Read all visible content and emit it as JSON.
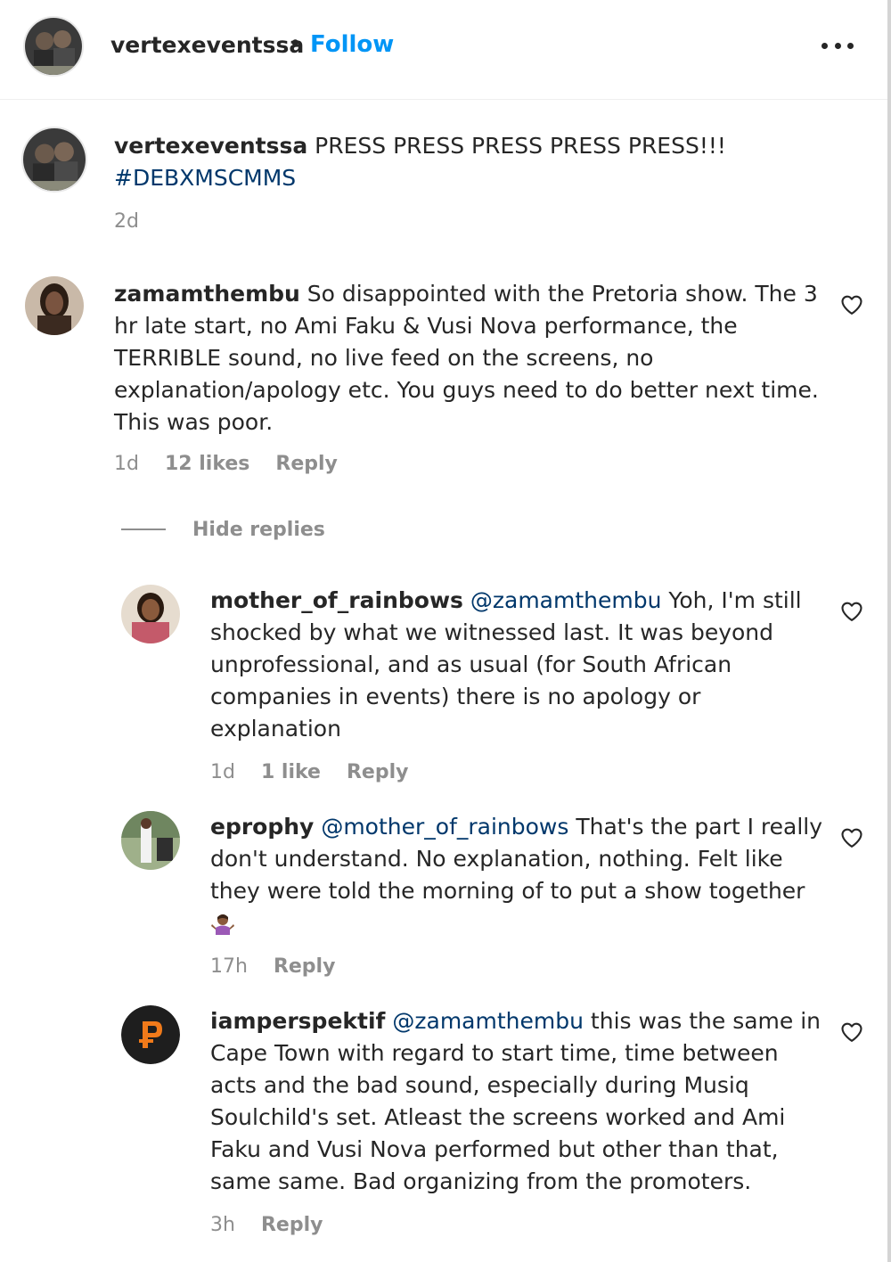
{
  "header": {
    "username": "vertexeventssa",
    "separator": "•",
    "follow_label": "Follow",
    "more_icon": "more-horizontal-icon"
  },
  "caption": {
    "username": "vertexeventssa",
    "text": "PRESS PRESS PRESS PRESS PRESS!!!",
    "hashtag": "#DEBXMSCMMS",
    "time": "2d"
  },
  "comments": [
    {
      "username": "zamamthembu",
      "text": "So disappointed with the Pretoria show. The 3 hr late start, no Ami Faku & Vusi Nova performance, the TERRIBLE sound, no live feed on the screens, no explanation/apology etc. You guys need to do better next time. This was poor.",
      "time": "1d",
      "likes": "12 likes",
      "reply_label": "Reply"
    }
  ],
  "hide_replies_label": "Hide replies",
  "replies": [
    {
      "username": "mother_of_rainbows",
      "mention": "@zamamthembu",
      "text": "Yoh, I'm still shocked by what we witnessed last. It was beyond unprofessional, and as usual (for South African companies in events) there is no apology or explanation",
      "time": "1d",
      "likes": "1 like",
      "reply_label": "Reply"
    },
    {
      "username": "eprophy",
      "mention": "@mother_of_rainbows",
      "text": "That's the part I really don't understand. No explanation, nothing. Felt like they were told the morning of to put a show together",
      "emoji": "🤷🏾‍♀️",
      "time": "17h",
      "reply_label": "Reply"
    },
    {
      "username": "iamperspektif",
      "mention": "@zamamthembu",
      "text": "this was the same in Cape Town with regard to start time, time between acts and the bad sound, especially during Musiq Soulchild's set. Atleast the screens worked and Ami Faku and Vusi Nova performed but other than that, same same. Bad organizing from the promoters.",
      "time": "3h",
      "reply_label": "Reply"
    }
  ],
  "icons": {
    "heart": "heart-outline-icon"
  }
}
